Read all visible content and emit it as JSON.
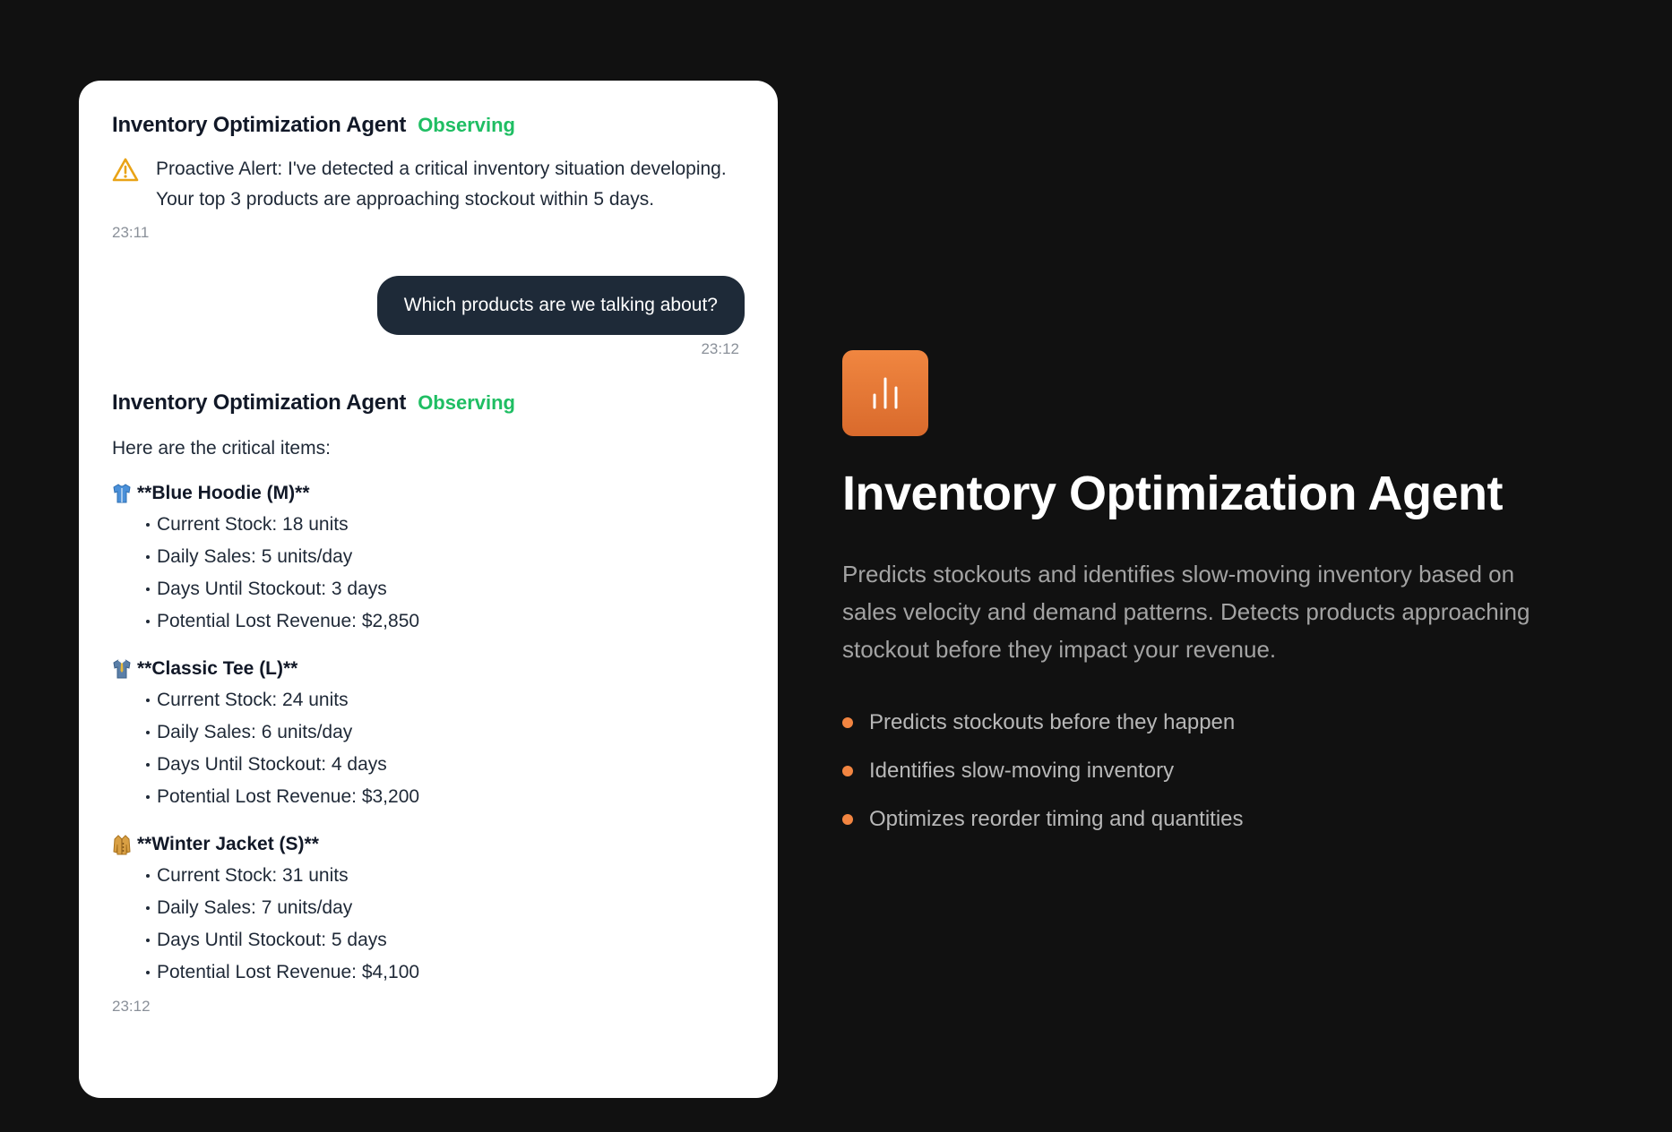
{
  "chat": {
    "messages": [
      {
        "sender": "Inventory Optimization Agent",
        "status": "Observing",
        "text": "Proactive Alert: I've detected a critical inventory situation developing. Your top 3 products are approaching stockout within 5 days.",
        "time": "23:11"
      },
      {
        "text": "Which products are we talking about?",
        "time": "23:12"
      },
      {
        "sender": "Inventory Optimization Agent",
        "status": "Observing",
        "intro": "Here are the critical items:",
        "time": "23:12",
        "products": [
          {
            "icon": "shirt-icon",
            "title": "**Blue Hoodie (M)**",
            "details": [
              "Current Stock: 18 units",
              "Daily Sales: 5 units/day",
              "Days Until Stockout: 3 days",
              "Potential Lost Revenue: $2,850"
            ]
          },
          {
            "icon": "tshirt-icon",
            "title": "**Classic Tee (L)**",
            "details": [
              "Current Stock: 24 units",
              "Daily Sales: 6 units/day",
              "Days Until Stockout: 4 days",
              "Potential Lost Revenue: $3,200"
            ]
          },
          {
            "icon": "coat-icon",
            "title": "**Winter Jacket (S)**",
            "details": [
              "Current Stock: 31 units",
              "Daily Sales: 7 units/day",
              "Days Until Stockout: 5 days",
              "Potential Lost Revenue: $4,100"
            ]
          }
        ]
      }
    ]
  },
  "hero": {
    "icon": "bar-chart-icon",
    "title": "Inventory Optimization Agent",
    "description": "Predicts stockouts and identifies slow-moving inventory based on sales velocity and demand patterns. Detects products approaching stockout before they impact your revenue.",
    "features": [
      "Predicts stockouts before they happen",
      "Identifies slow-moving inventory",
      "Optimizes reorder timing and quantities"
    ]
  },
  "colors": {
    "background": "#111111",
    "status_green": "#1fbe63",
    "accent_orange": "#f28541",
    "user_bubble": "#1e2a38"
  }
}
